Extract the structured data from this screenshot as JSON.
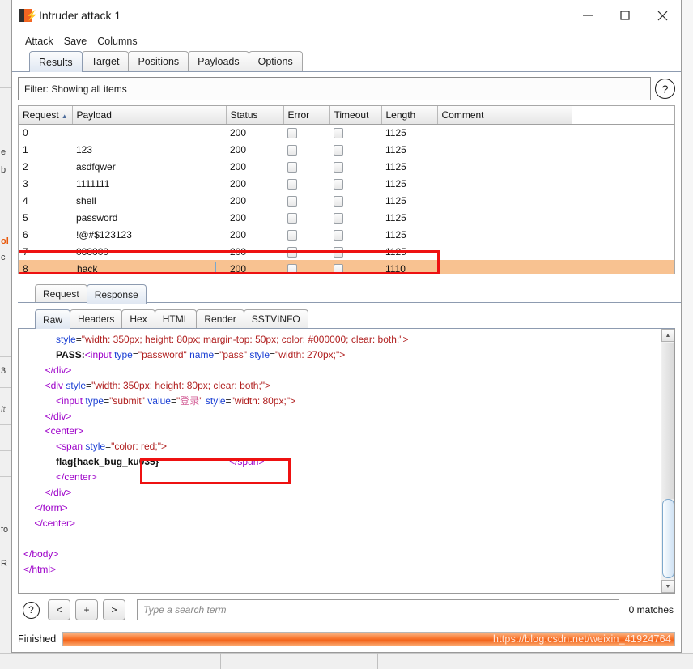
{
  "window": {
    "title": "Intruder attack 1",
    "icon": "burp-suite-icon",
    "minimize_label": "—",
    "maximize_label": "□",
    "close_label": "✕"
  },
  "menubar": {
    "items": [
      {
        "label": "Attack"
      },
      {
        "label": "Save"
      },
      {
        "label": "Columns"
      }
    ]
  },
  "tabs": {
    "items": [
      {
        "label": "Results",
        "active": true
      },
      {
        "label": "Target",
        "active": false
      },
      {
        "label": "Positions",
        "active": false
      },
      {
        "label": "Payloads",
        "active": false
      },
      {
        "label": "Options",
        "active": false
      }
    ]
  },
  "filter": {
    "text": "Filter: Showing all items",
    "help_label": "?"
  },
  "results_table": {
    "columns": [
      "Request",
      "Payload",
      "Status",
      "Error",
      "Timeout",
      "Length",
      "Comment"
    ],
    "sort_column": "Request",
    "sort_arrow": "▲",
    "rows": [
      {
        "request": "0",
        "payload": "",
        "status": "200",
        "error": false,
        "timeout": false,
        "length": "1125",
        "comment": "",
        "highlight": false
      },
      {
        "request": "1",
        "payload": "123",
        "status": "200",
        "error": false,
        "timeout": false,
        "length": "1125",
        "comment": "",
        "highlight": false
      },
      {
        "request": "2",
        "payload": "asdfqwer",
        "status": "200",
        "error": false,
        "timeout": false,
        "length": "1125",
        "comment": "",
        "highlight": false
      },
      {
        "request": "3",
        "payload": "1111111",
        "status": "200",
        "error": false,
        "timeout": false,
        "length": "1125",
        "comment": "",
        "highlight": false
      },
      {
        "request": "4",
        "payload": "shell",
        "status": "200",
        "error": false,
        "timeout": false,
        "length": "1125",
        "comment": "",
        "highlight": false
      },
      {
        "request": "5",
        "payload": "password",
        "status": "200",
        "error": false,
        "timeout": false,
        "length": "1125",
        "comment": "",
        "highlight": false
      },
      {
        "request": "6",
        "payload": "!@#$123123",
        "status": "200",
        "error": false,
        "timeout": false,
        "length": "1125",
        "comment": "",
        "highlight": false
      },
      {
        "request": "7",
        "payload": "000000",
        "status": "200",
        "error": false,
        "timeout": false,
        "length": "1125",
        "comment": "",
        "highlight": false
      },
      {
        "request": "8",
        "payload": "hack",
        "status": "200",
        "error": false,
        "timeout": false,
        "length": "1110",
        "comment": "",
        "highlight": true
      }
    ]
  },
  "message_tabs": {
    "items": [
      {
        "label": "Request",
        "active": false
      },
      {
        "label": "Response",
        "active": true
      }
    ]
  },
  "view_tabs": {
    "items": [
      {
        "label": "Raw",
        "active": true
      },
      {
        "label": "Headers",
        "active": false
      },
      {
        "label": "Hex",
        "active": false
      },
      {
        "label": "HTML",
        "active": false
      },
      {
        "label": "Render",
        "active": false
      },
      {
        "label": "SSTVINFO",
        "active": false
      }
    ]
  },
  "response_body": {
    "flag": "flag{hack_bug_ku035}",
    "lines": [
      "            style=\"width: 350px; height: 80px; margin-top: 50px; color: #000000; clear: both;\">",
      "            PASS:<input type=\"password\" name=\"pass\" style=\"width: 270px;\">",
      "        </div>",
      "        <div style=\"width: 350px; height: 80px; clear: both;\">",
      "            <input type=\"submit\" value=\"登录\" style=\"width: 80px;\">",
      "        </div>",
      "        <center>",
      "            <span style=\"color: red;\">",
      "            flag{hack_bug_ku035}                          </span>",
      "            </center>",
      "        </div>",
      "    </form>",
      "    </center>",
      "",
      "</body>",
      "</html>"
    ]
  },
  "search_bar": {
    "help_label": "?",
    "prev_label": "<",
    "add_label": "+",
    "next_label": ">",
    "placeholder": "Type a search term",
    "value": "",
    "matches": "0 matches"
  },
  "status_bar": {
    "label": "Finished",
    "progress_percent": 100,
    "watermark": "https://blog.csdn.net/weixin_41924764"
  },
  "annotations": {
    "row_box_color": "#ee1111",
    "flag_box_color": "#ee1111"
  },
  "background_window": {
    "fragments": [
      "e",
      "b",
      "ol",
      "c",
      "3",
      "it",
      "fo",
      "R"
    ]
  }
}
